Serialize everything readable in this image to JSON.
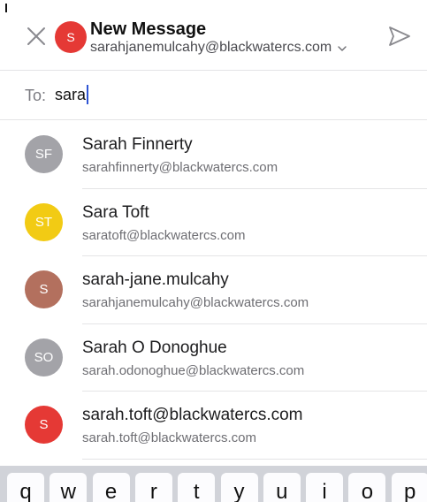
{
  "header": {
    "title": "New Message",
    "account": "sarahjanemulcahy@blackwatercs.com",
    "sender_initial": "S",
    "sender_color": "#e53935"
  },
  "compose": {
    "to_label": "To:",
    "to_value": "sara"
  },
  "suggestions": [
    {
      "initials": "SF",
      "name": "Sarah Finnerty",
      "email": "sarahfinnerty@blackwatercs.com",
      "color": "#a3a3a8"
    },
    {
      "initials": "ST",
      "name": "Sara Toft",
      "email": "saratoft@blackwatercs.com",
      "color": "#f2cb14"
    },
    {
      "initials": "S",
      "name": "sarah-jane.mulcahy",
      "email": "sarahjanemulcahy@blackwatercs.com",
      "color": "#b3705e"
    },
    {
      "initials": "SO",
      "name": "Sarah O Donoghue",
      "email": "sarah.odonoghue@blackwatercs.com",
      "color": "#a3a3a8"
    },
    {
      "initials": "S",
      "name": "sarah.toft@blackwatercs.com",
      "email": "sarah.toft@blackwatercs.com",
      "color": "#e53935"
    }
  ],
  "keyboard": {
    "keys": [
      "q",
      "w",
      "e",
      "r",
      "t",
      "y",
      "u",
      "i",
      "o",
      "p"
    ]
  },
  "icons": {
    "close": "close-icon",
    "send": "send-icon",
    "chevron": "chevron-down-icon"
  }
}
